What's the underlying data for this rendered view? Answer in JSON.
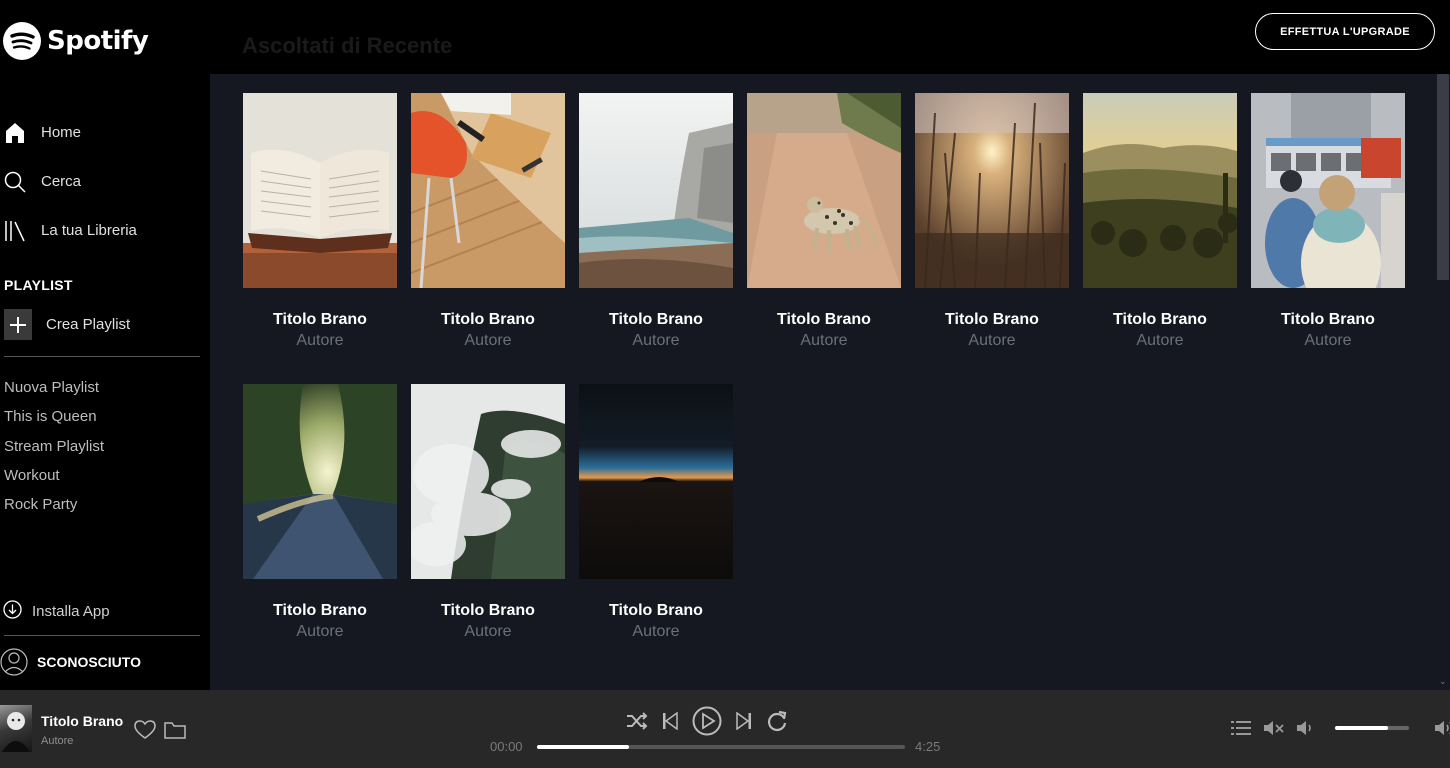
{
  "brand": {
    "name": "Spotify"
  },
  "nav": [
    {
      "label": "Home",
      "icon": "home-icon"
    },
    {
      "label": "Cerca",
      "icon": "search-icon"
    },
    {
      "label": "La tua Libreria",
      "icon": "library-icon"
    }
  ],
  "playlist_section": {
    "title": "PLAYLIST",
    "create_label": "Crea Playlist",
    "items": [
      "Nuova Playlist",
      "This is Queen",
      "Stream Playlist",
      "Workout",
      "Rock Party"
    ]
  },
  "install_label": "Installa App",
  "user": {
    "name": "SCONOSCIUTO"
  },
  "header": {
    "title": "Ascoltati di Recente",
    "upgrade_label": "EFFETTUA L'UPGRADE"
  },
  "cards": [
    {
      "title": "Titolo Brano",
      "author": "Autore",
      "image": "open-book"
    },
    {
      "title": "Titolo Brano",
      "author": "Autore",
      "image": "desk-with-chair"
    },
    {
      "title": "Titolo Brano",
      "author": "Autore",
      "image": "foggy-coast"
    },
    {
      "title": "Titolo Brano",
      "author": "Autore",
      "image": "leopard-on-path"
    },
    {
      "title": "Titolo Brano",
      "author": "Autore",
      "image": "sunlit-grass"
    },
    {
      "title": "Titolo Brano",
      "author": "Autore",
      "image": "valley-landscape"
    },
    {
      "title": "Titolo Brano",
      "author": "Autore",
      "image": "city-street-travelers"
    },
    {
      "title": "Titolo Brano",
      "author": "Autore",
      "image": "forest-road"
    },
    {
      "title": "Titolo Brano",
      "author": "Autore",
      "image": "misty-mountain"
    },
    {
      "title": "Titolo Brano",
      "author": "Autore",
      "image": "night-horizon"
    }
  ],
  "now_playing": {
    "title": "Titolo Brano",
    "author": "Autore",
    "elapsed": "00:00",
    "duration": "4:25",
    "progress": 0.25,
    "volume": 0.72
  },
  "colors": {
    "background": "#151821",
    "sidebar": "#000000",
    "player": "#282828",
    "muted_text": "#6c707a"
  }
}
